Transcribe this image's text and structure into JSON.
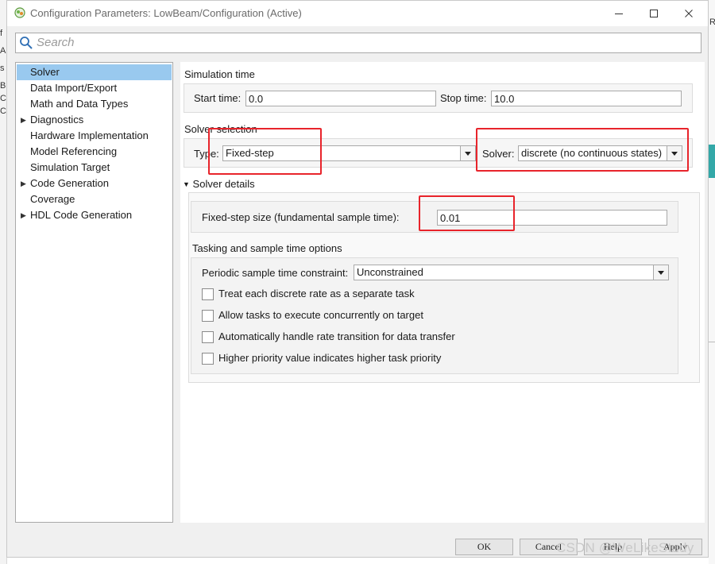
{
  "window": {
    "title": "Configuration Parameters: LowBeam/Configuration (Active)"
  },
  "search": {
    "placeholder": "Search"
  },
  "background": {
    "left_fragments": [
      "f",
      "A",
      "s",
      "B",
      "C",
      "C"
    ],
    "right_fragment": "R"
  },
  "tree": {
    "items": [
      {
        "label": "Solver",
        "selected": true,
        "expandable": false
      },
      {
        "label": "Data Import/Export",
        "expandable": false
      },
      {
        "label": "Math and Data Types",
        "expandable": false
      },
      {
        "label": "Diagnostics",
        "expandable": true
      },
      {
        "label": "Hardware Implementation",
        "expandable": false
      },
      {
        "label": "Model Referencing",
        "expandable": false
      },
      {
        "label": "Simulation Target",
        "expandable": false
      },
      {
        "label": "Code Generation",
        "expandable": true
      },
      {
        "label": "Coverage",
        "expandable": false
      },
      {
        "label": "HDL Code Generation",
        "expandable": true
      }
    ]
  },
  "simulation_time": {
    "heading": "Simulation time",
    "start_label": "Start time:",
    "start_value": "0.0",
    "stop_label": "Stop time:",
    "stop_value": "10.0"
  },
  "solver_selection": {
    "heading": "Solver selection",
    "type_label": "Type:",
    "type_value": "Fixed-step",
    "solver_label": "Solver:",
    "solver_value": "discrete (no continuous states)"
  },
  "solver_details": {
    "heading": "Solver details",
    "step_label": "Fixed-step size (fundamental sample time):",
    "step_value": "0.01"
  },
  "tasking": {
    "heading": "Tasking and sample time options",
    "constraint_label": "Periodic sample time constraint:",
    "constraint_value": "Unconstrained",
    "options": [
      {
        "label": "Treat each discrete rate as a separate task",
        "checked": false
      },
      {
        "label": "Allow tasks to execute concurrently on target",
        "checked": false
      },
      {
        "label": "Automatically handle rate transition for data transfer",
        "checked": false
      },
      {
        "label": "Higher priority value indicates higher task priority",
        "checked": false
      }
    ]
  },
  "footer": {
    "ok": "OK",
    "cancel": "Cancel",
    "help": "Help",
    "apply": "Apply"
  },
  "watermark": "CSDN @WeLikeStudy",
  "colors": {
    "selection": "#99c9ef",
    "annotation": "#e8242b"
  }
}
